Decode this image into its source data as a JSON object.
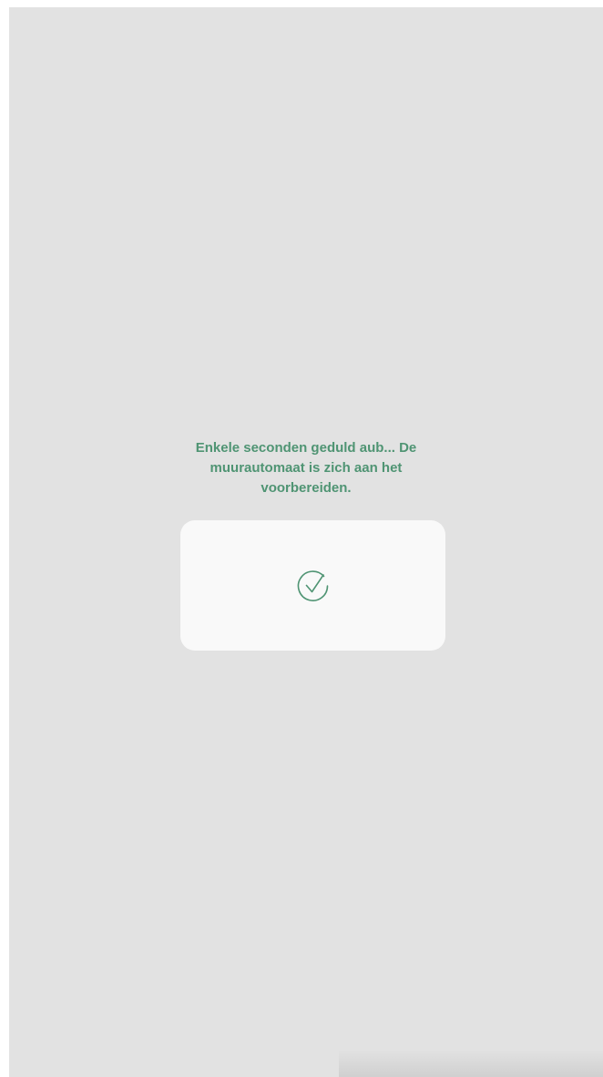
{
  "loading": {
    "message": "Enkele seconden geduld aub... De muurautomaat is zich aan het voorbereiden."
  },
  "status_card": {
    "icon": "check-circle-icon",
    "state": "success"
  },
  "colors": {
    "accent": "#4f9473",
    "background": "#e2e2e2",
    "card": "#f9f9f9"
  }
}
